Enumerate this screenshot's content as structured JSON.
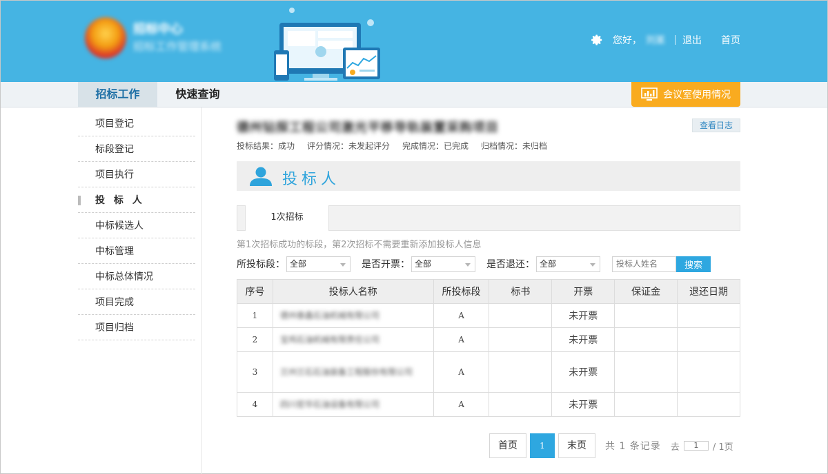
{
  "header": {
    "brand_line1": "招标中心",
    "brand_line2": "招标工作管理系统",
    "greeting": "您好，",
    "user_name": "刘某",
    "logout_label": "退出",
    "home_label": "首页"
  },
  "nav": {
    "tabs": [
      {
        "label": "招标工作",
        "active": true
      },
      {
        "label": "快速查询",
        "active": false
      }
    ],
    "meeting_button": "会议室使用情况"
  },
  "sidebar": {
    "items": [
      {
        "label": "项目登记"
      },
      {
        "label": "标段登记"
      },
      {
        "label": "项目执行"
      },
      {
        "label": "投 标 人",
        "active": true
      },
      {
        "label": "中标候选人"
      },
      {
        "label": "中标管理"
      },
      {
        "label": "中标总体情况"
      },
      {
        "label": "项目完成"
      },
      {
        "label": "项目归档"
      }
    ]
  },
  "project": {
    "title": "德州钻探工程公司激光平移导轨装置采购项目",
    "log_button": "查看日志",
    "status": {
      "result": "投标结果：成功",
      "score": "评分情况：未发起评分",
      "complete": "完成情况：已完成",
      "archive": "归档情况：未归档"
    }
  },
  "section": {
    "title": "投标人"
  },
  "tabs": {
    "first": "1次招标"
  },
  "note": "第1次招标成功的标段，第2次招标不需要重新添加投标人信息",
  "filters": {
    "segment_label": "所投标段：",
    "segment_value": "全部",
    "invoice_label": "是否开票：",
    "invoice_value": "全部",
    "refund_label": "是否退还：",
    "refund_value": "全部",
    "name_placeholder": "投标人姓名",
    "search_label": "搜索"
  },
  "table": {
    "columns": [
      "序号",
      "投标人名称",
      "所投标段",
      "标书",
      "开票",
      "保证金",
      "退还日期"
    ],
    "rows": [
      {
        "seq": "1",
        "name": "德州泰鑫石油机械有限公司",
        "segment": "A",
        "bid_doc": "",
        "invoice": "未开票",
        "deposit": "",
        "refund_date": ""
      },
      {
        "seq": "2",
        "name": "宝鸡石油机械有限责任公司",
        "segment": "A",
        "bid_doc": "",
        "invoice": "未开票",
        "deposit": "",
        "refund_date": ""
      },
      {
        "seq": "3",
        "name": "兰州兰石石油装备工程股份有限公司",
        "segment": "A",
        "bid_doc": "",
        "invoice": "未开票",
        "deposit": "",
        "refund_date": ""
      },
      {
        "seq": "4",
        "name": "四川宏华石油设备有限公司",
        "segment": "A",
        "bid_doc": "",
        "invoice": "未开票",
        "deposit": "",
        "refund_date": ""
      }
    ]
  },
  "pager": {
    "first_label": "首页",
    "current_page": "1",
    "last_label": "末页",
    "total_text": "共 1 条记录",
    "go_label": "去",
    "go_value": "1",
    "pages_text": "/ 1页"
  },
  "colors": {
    "header_bg": "#45b4e3",
    "accent": "#2ea7e0",
    "meeting_button": "#f9ab1f"
  }
}
